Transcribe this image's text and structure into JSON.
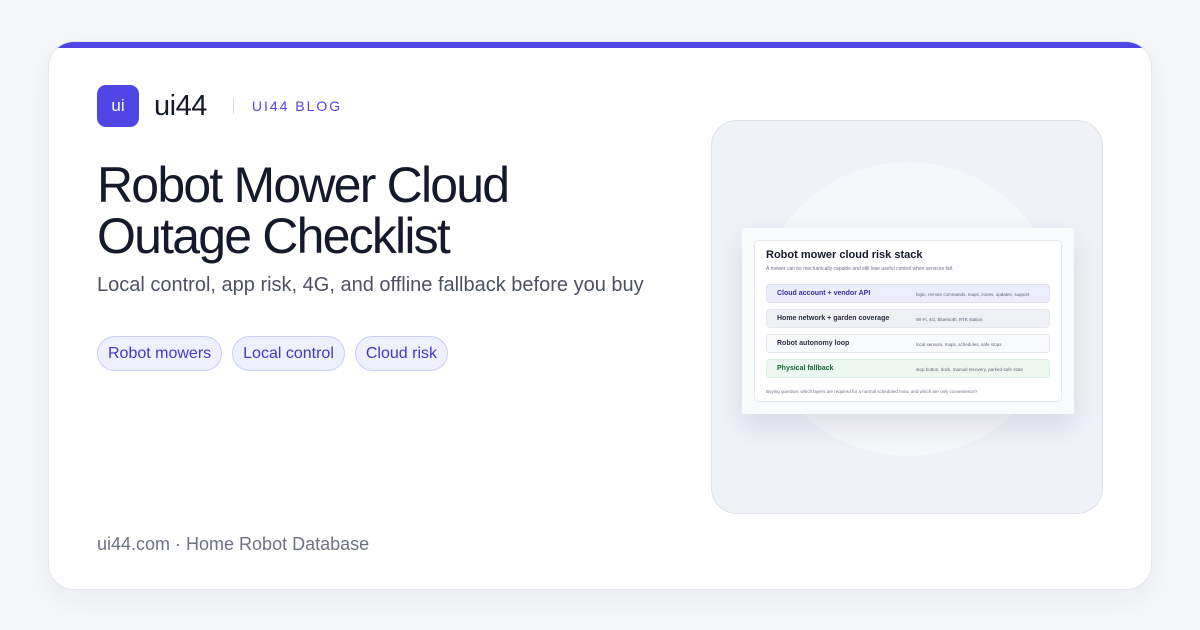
{
  "brand": {
    "logo_text": "ui",
    "name": "ui44",
    "section_label": "UI44 BLOG"
  },
  "article": {
    "title": "Robot Mower Cloud Outage Checklist",
    "subtitle": "Local control, app risk, 4G, and offline fallback before you buy",
    "tags": [
      "Robot mowers",
      "Local control",
      "Cloud risk"
    ]
  },
  "footer": {
    "text": "ui44.com · Home Robot Database"
  },
  "preview": {
    "title": "Robot mower cloud risk stack",
    "subtitle": "A mower can be mechanically capable and still lose useful control when services fail.",
    "rows": [
      {
        "label": "Cloud account + vendor API",
        "detail": "login, remote commands, maps, zones, updates, support"
      },
      {
        "label": "Home network + garden coverage",
        "detail": "Wi-Fi, 4G, Bluetooth, RTK station"
      },
      {
        "label": "Robot autonomy loop",
        "detail": "local sensors, maps, schedules, safe stops"
      },
      {
        "label": "Physical fallback",
        "detail": "stop button, dock, manual recovery, parked-safe state"
      }
    ],
    "question": "Buying question: which layers are required for a normal scheduled mow, and which are only convenience?"
  },
  "colors": {
    "accent": "#4f46e5",
    "title": "#141a2b",
    "fallback_green": "#166534"
  }
}
